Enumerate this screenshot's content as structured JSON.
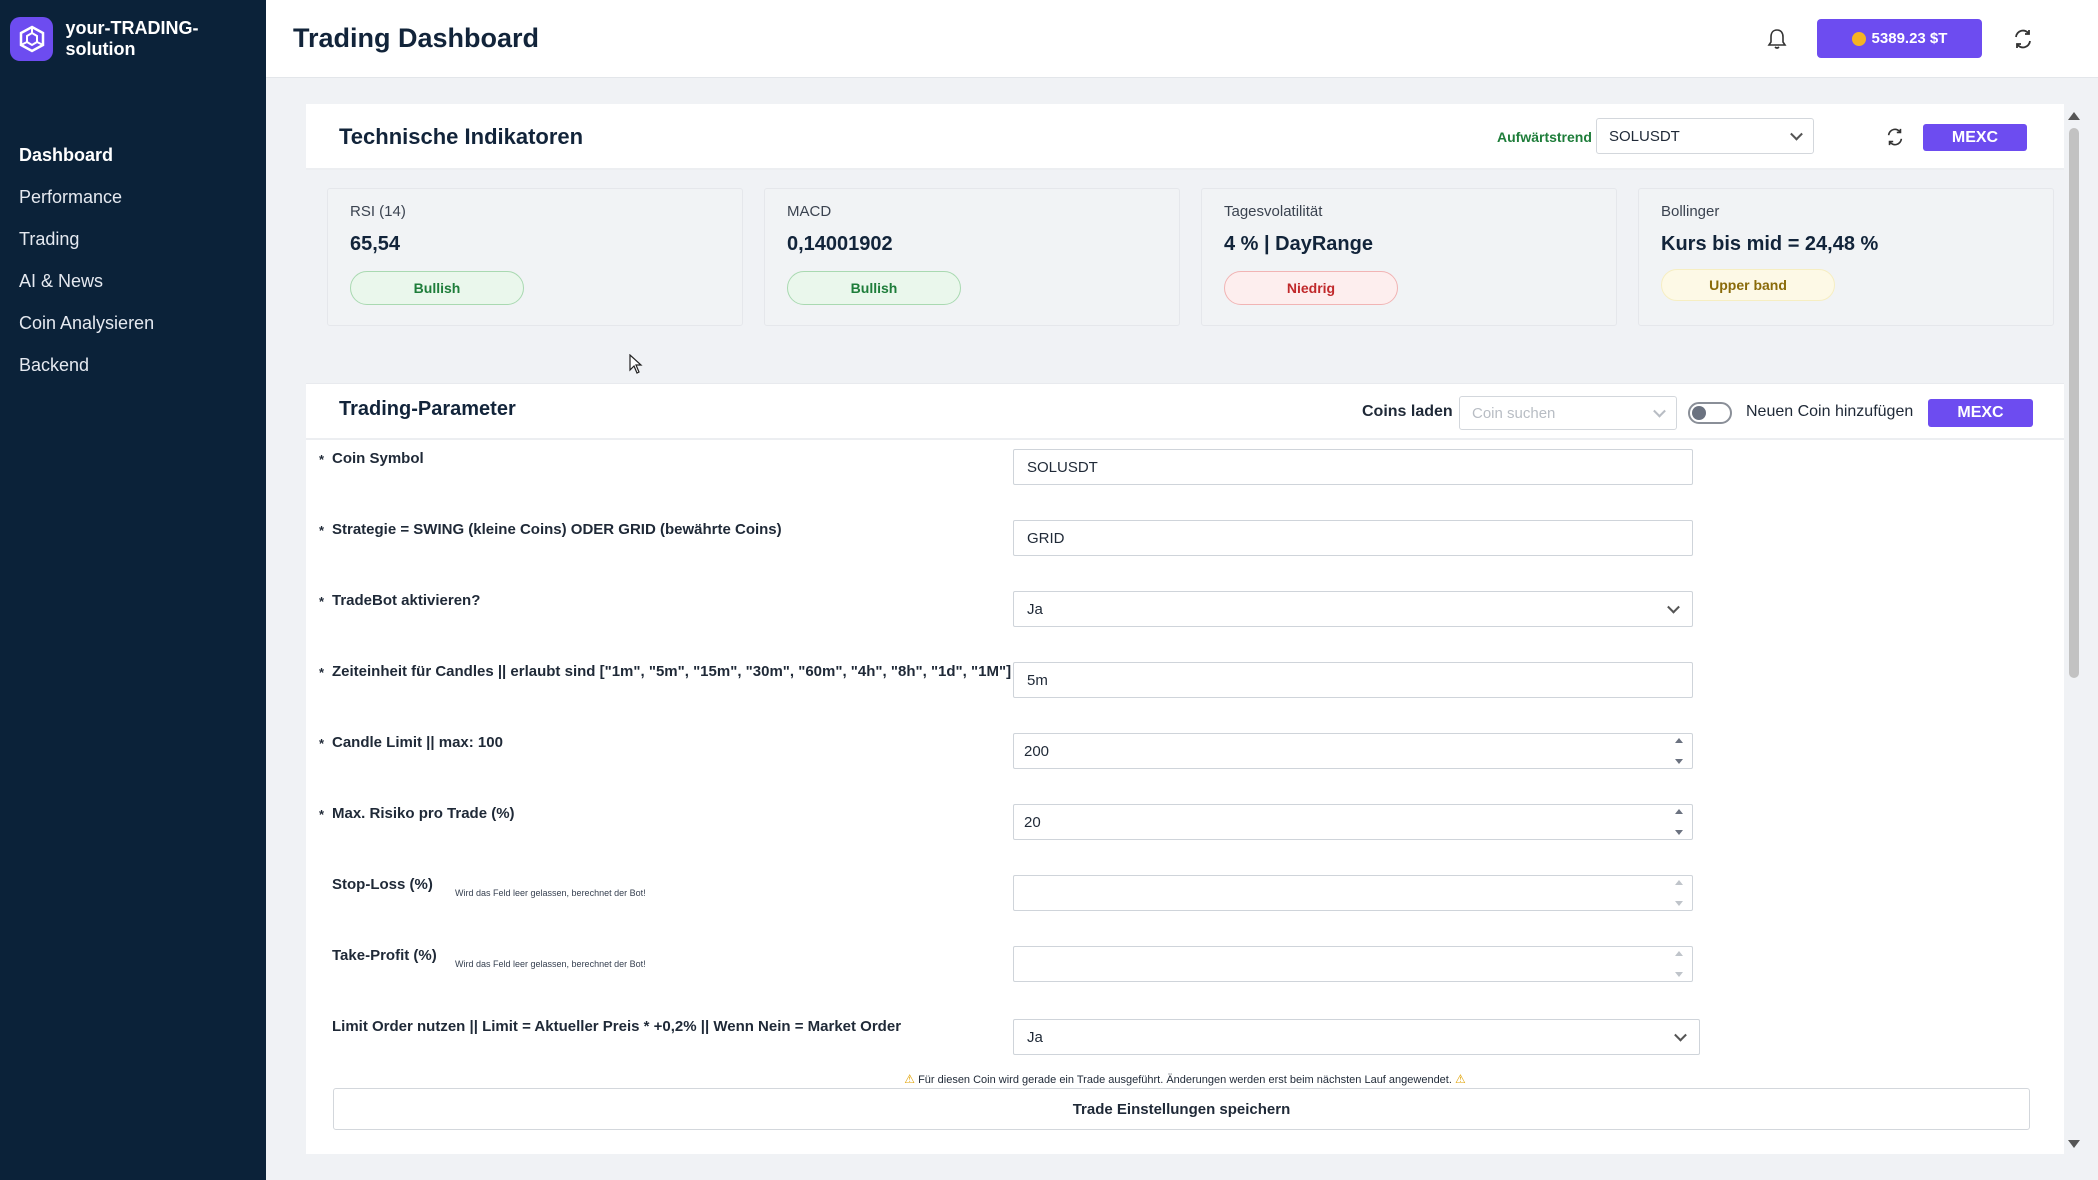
{
  "app": {
    "name": "your-TRADING-solution"
  },
  "sidebar": {
    "items": [
      {
        "label": "Dashboard",
        "active": true
      },
      {
        "label": "Performance"
      },
      {
        "label": "Trading"
      },
      {
        "label": "AI & News"
      },
      {
        "label": "Coin Analysieren"
      },
      {
        "label": "Backend"
      }
    ]
  },
  "header": {
    "title": "Trading Dashboard",
    "balance": "5389.23 $T"
  },
  "indicators": {
    "title": "Technische Indikatoren",
    "trend": "Aufwärtstrend",
    "symbol": "SOLUSDT",
    "exchange": "MEXC",
    "cards": [
      {
        "label": "RSI (14)",
        "value": "65,54",
        "badge": "Bullish"
      },
      {
        "label": "MACD",
        "value": "0,14001902",
        "badge": "Bullish"
      },
      {
        "label": "Tagesvolatilität",
        "value": "4 % | DayRange",
        "badge": "Niedrig"
      },
      {
        "label": "Bollinger",
        "value": "Kurs bis mid = 24,48 %",
        "badge": "Upper band"
      }
    ]
  },
  "params": {
    "title": "Trading-Parameter",
    "coins_label": "Coins laden",
    "coin_search_placeholder": "Coin suchen",
    "add_coin_label": "Neuen Coin hinzufügen",
    "add_coin_enabled": false,
    "exchange": "MEXC",
    "fields": [
      {
        "label": "Coin Symbol",
        "value": "SOLUSDT",
        "required": "*"
      },
      {
        "label": "Strategie = SWING (kleine Coins) ODER GRID (bewährte Coins)",
        "value": "GRID",
        "required": "*"
      },
      {
        "label": "TradeBot aktivieren?",
        "value": "Ja",
        "required": "*"
      },
      {
        "label": "Zeiteinheit für Candles || erlaubt sind [\"1m\", \"5m\", \"15m\", \"30m\", \"60m\", \"4h\", \"8h\", \"1d\", \"1M\"]",
        "value": "5m",
        "required": "*"
      },
      {
        "label": "Candle Limit || max: 100",
        "value": "200",
        "required": "*"
      },
      {
        "label": "Max. Risiko pro Trade (%)",
        "value": "20",
        "required": "*"
      },
      {
        "label": "Stop-Loss (%)",
        "value": "",
        "hint": "Wird das Feld leer gelassen, berechnet der Bot!"
      },
      {
        "label": "Take-Profit (%)",
        "value": "",
        "hint": "Wird das Feld leer gelassen, berechnet der Bot!"
      },
      {
        "label": "Limit Order nutzen || Limit = Aktueller Preis * +0,2% || Wenn Nein = Market Order",
        "value": "Ja"
      }
    ],
    "warning": "Für diesen Coin wird gerade ein Trade ausgeführt. Änderungen werden erst beim nächsten Lauf angewendet.",
    "save_label": "Trade Einstellungen speichern"
  },
  "colors": {
    "sidebar_bg": "#0b2239",
    "accent": "#6d4cf0",
    "bullish": "#1e7d3a",
    "low": "#c0292b"
  }
}
